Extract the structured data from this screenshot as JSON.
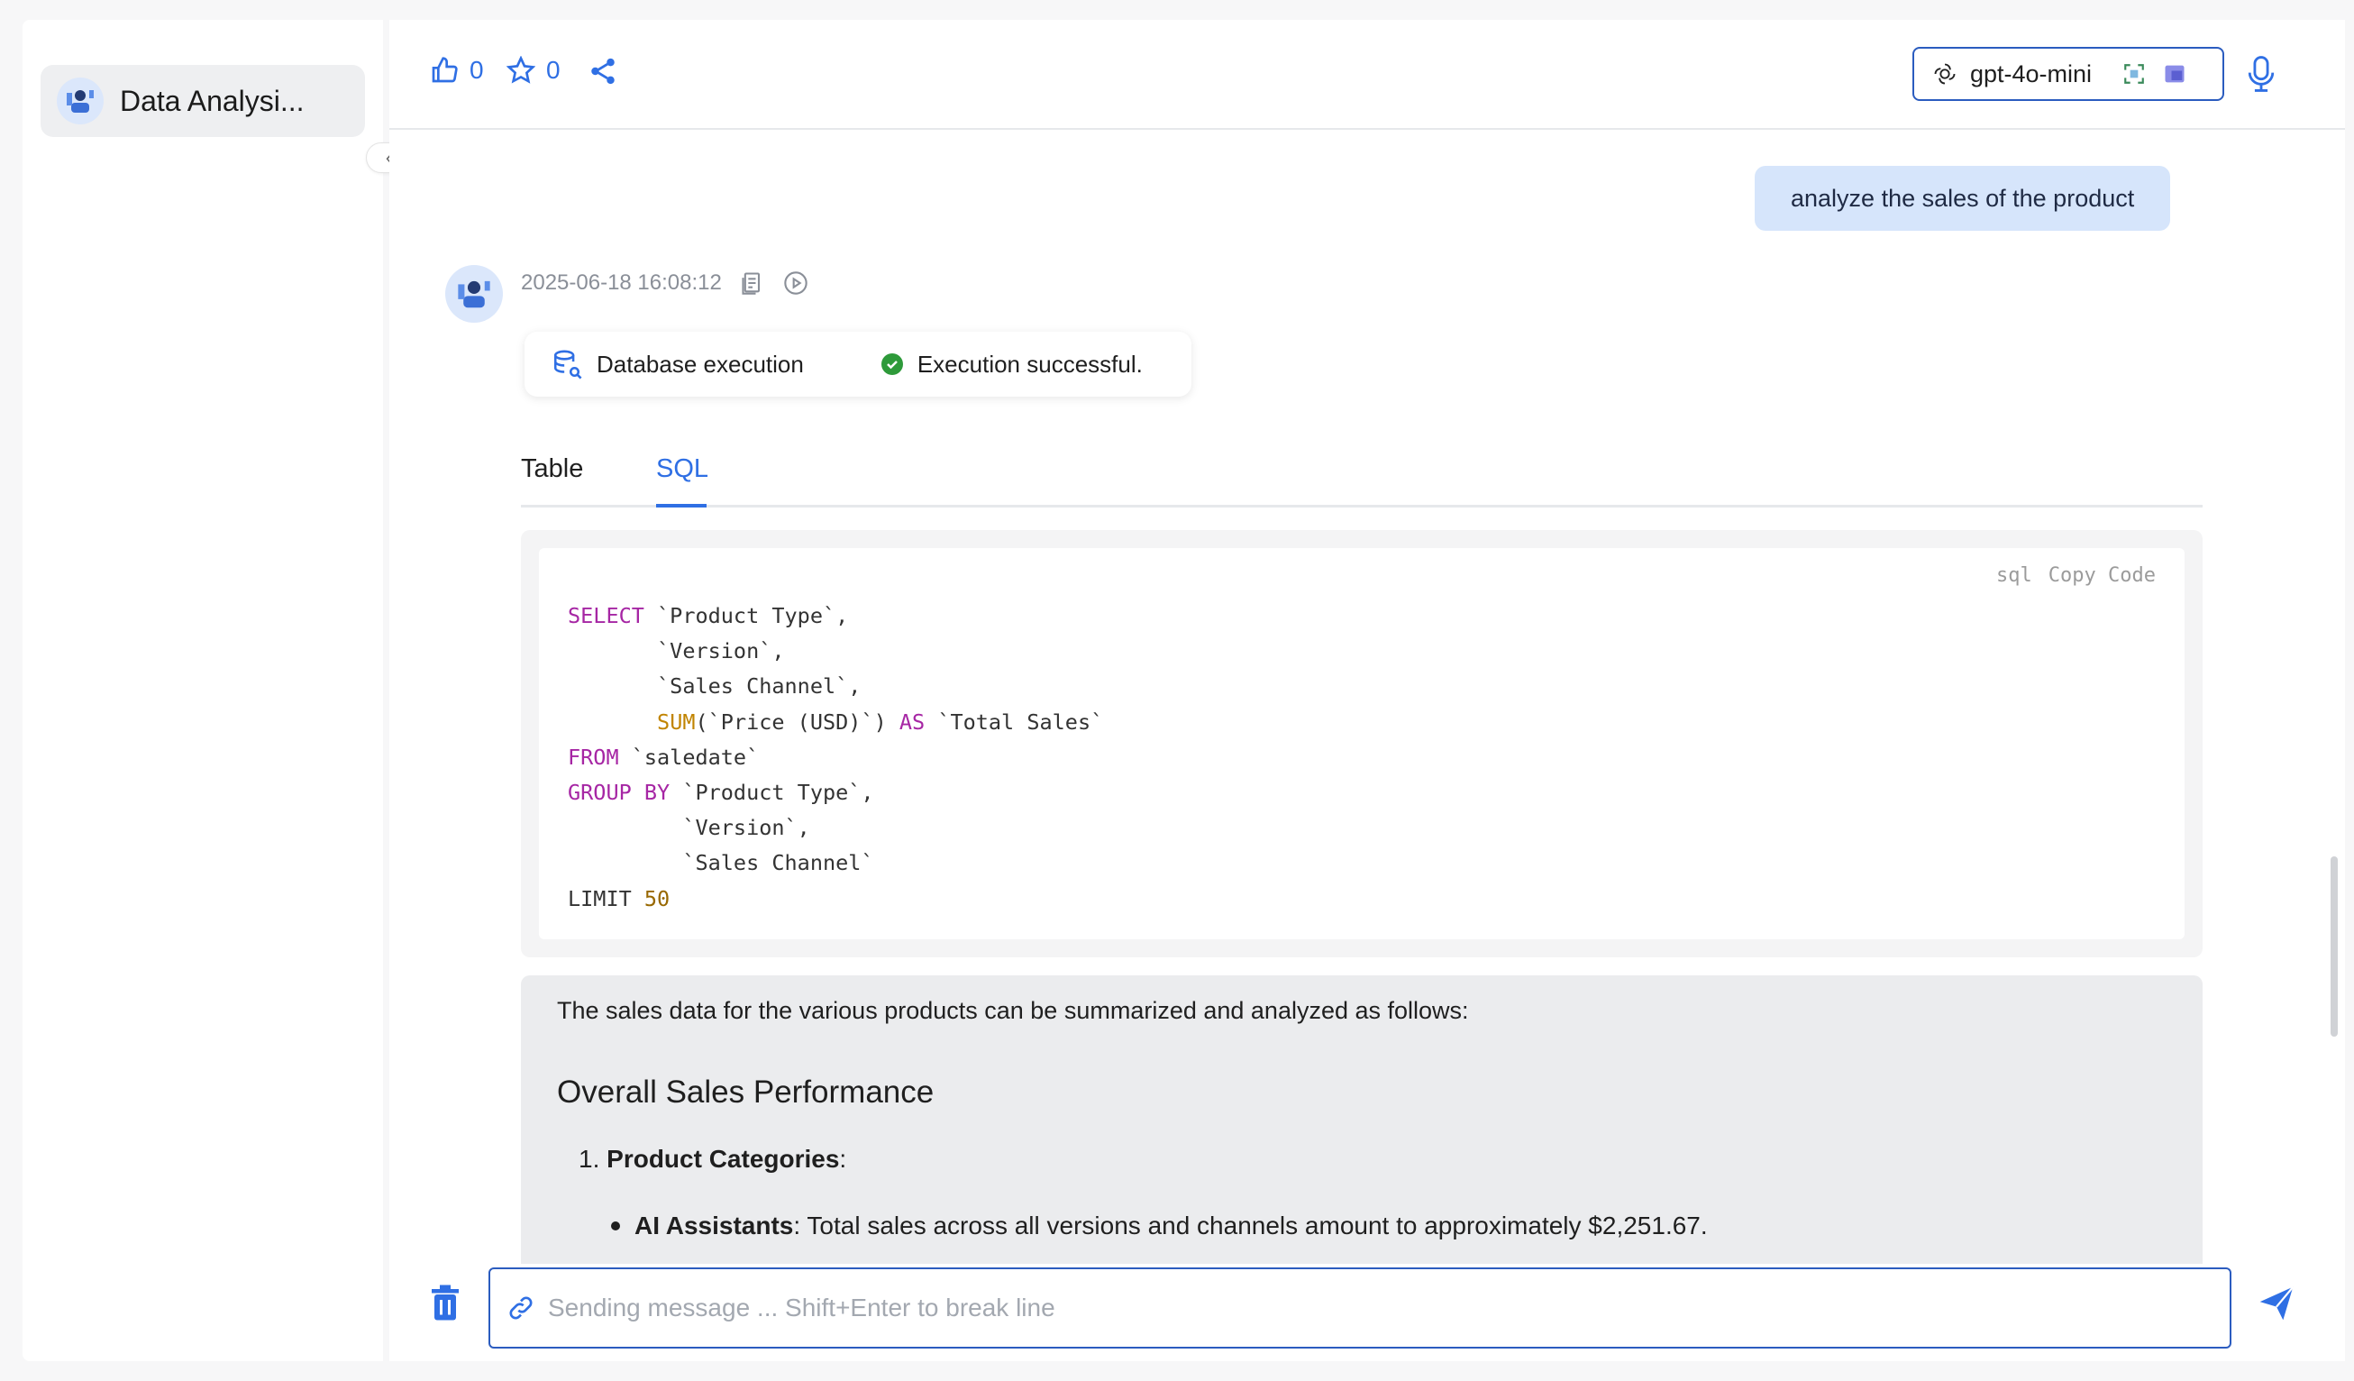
{
  "sidebar": {
    "chat_title": "Data Analysi..."
  },
  "toolbar": {
    "likes": "0",
    "stars": "0"
  },
  "model": {
    "name": "gpt-4o-mini"
  },
  "user_message": "analyze the sales of the product",
  "bot": {
    "timestamp": "2025-06-18 16:08:12",
    "execution": {
      "label": "Database execution",
      "status": "Execution successful.",
      "status_color": "#2e9a3a"
    }
  },
  "tabs": [
    {
      "label": "Table"
    },
    {
      "label": "SQL"
    }
  ],
  "code": {
    "language": "sql",
    "copy_label": "Copy Code",
    "lines": [
      "SELECT `Product Type`,",
      "       `Version`,",
      "       `Sales Channel`,",
      "       SUM(`Price (USD)`) AS `Total Sales`",
      "FROM `saledate`",
      "GROUP BY `Product Type`,",
      "         `Version`,",
      "         `Sales Channel`",
      "LIMIT 50"
    ]
  },
  "answer": {
    "intro": "The sales data for the various products can be summarized and analyzed as follows:",
    "heading": "Overall Sales Performance",
    "list_number": "1.",
    "item1_bold": "Product Categories",
    "item1_suffix": ":",
    "sub_bold": "AI Assistants",
    "sub_text": ": Total sales across all versions and channels amount to approximately $2,251.67."
  },
  "input": {
    "placeholder": "Sending message ... Shift+Enter to break line"
  },
  "colors": {
    "accent": "#2f6fe4",
    "user_bubble": "#d6e5fb",
    "answer_bg": "#ebecee"
  }
}
